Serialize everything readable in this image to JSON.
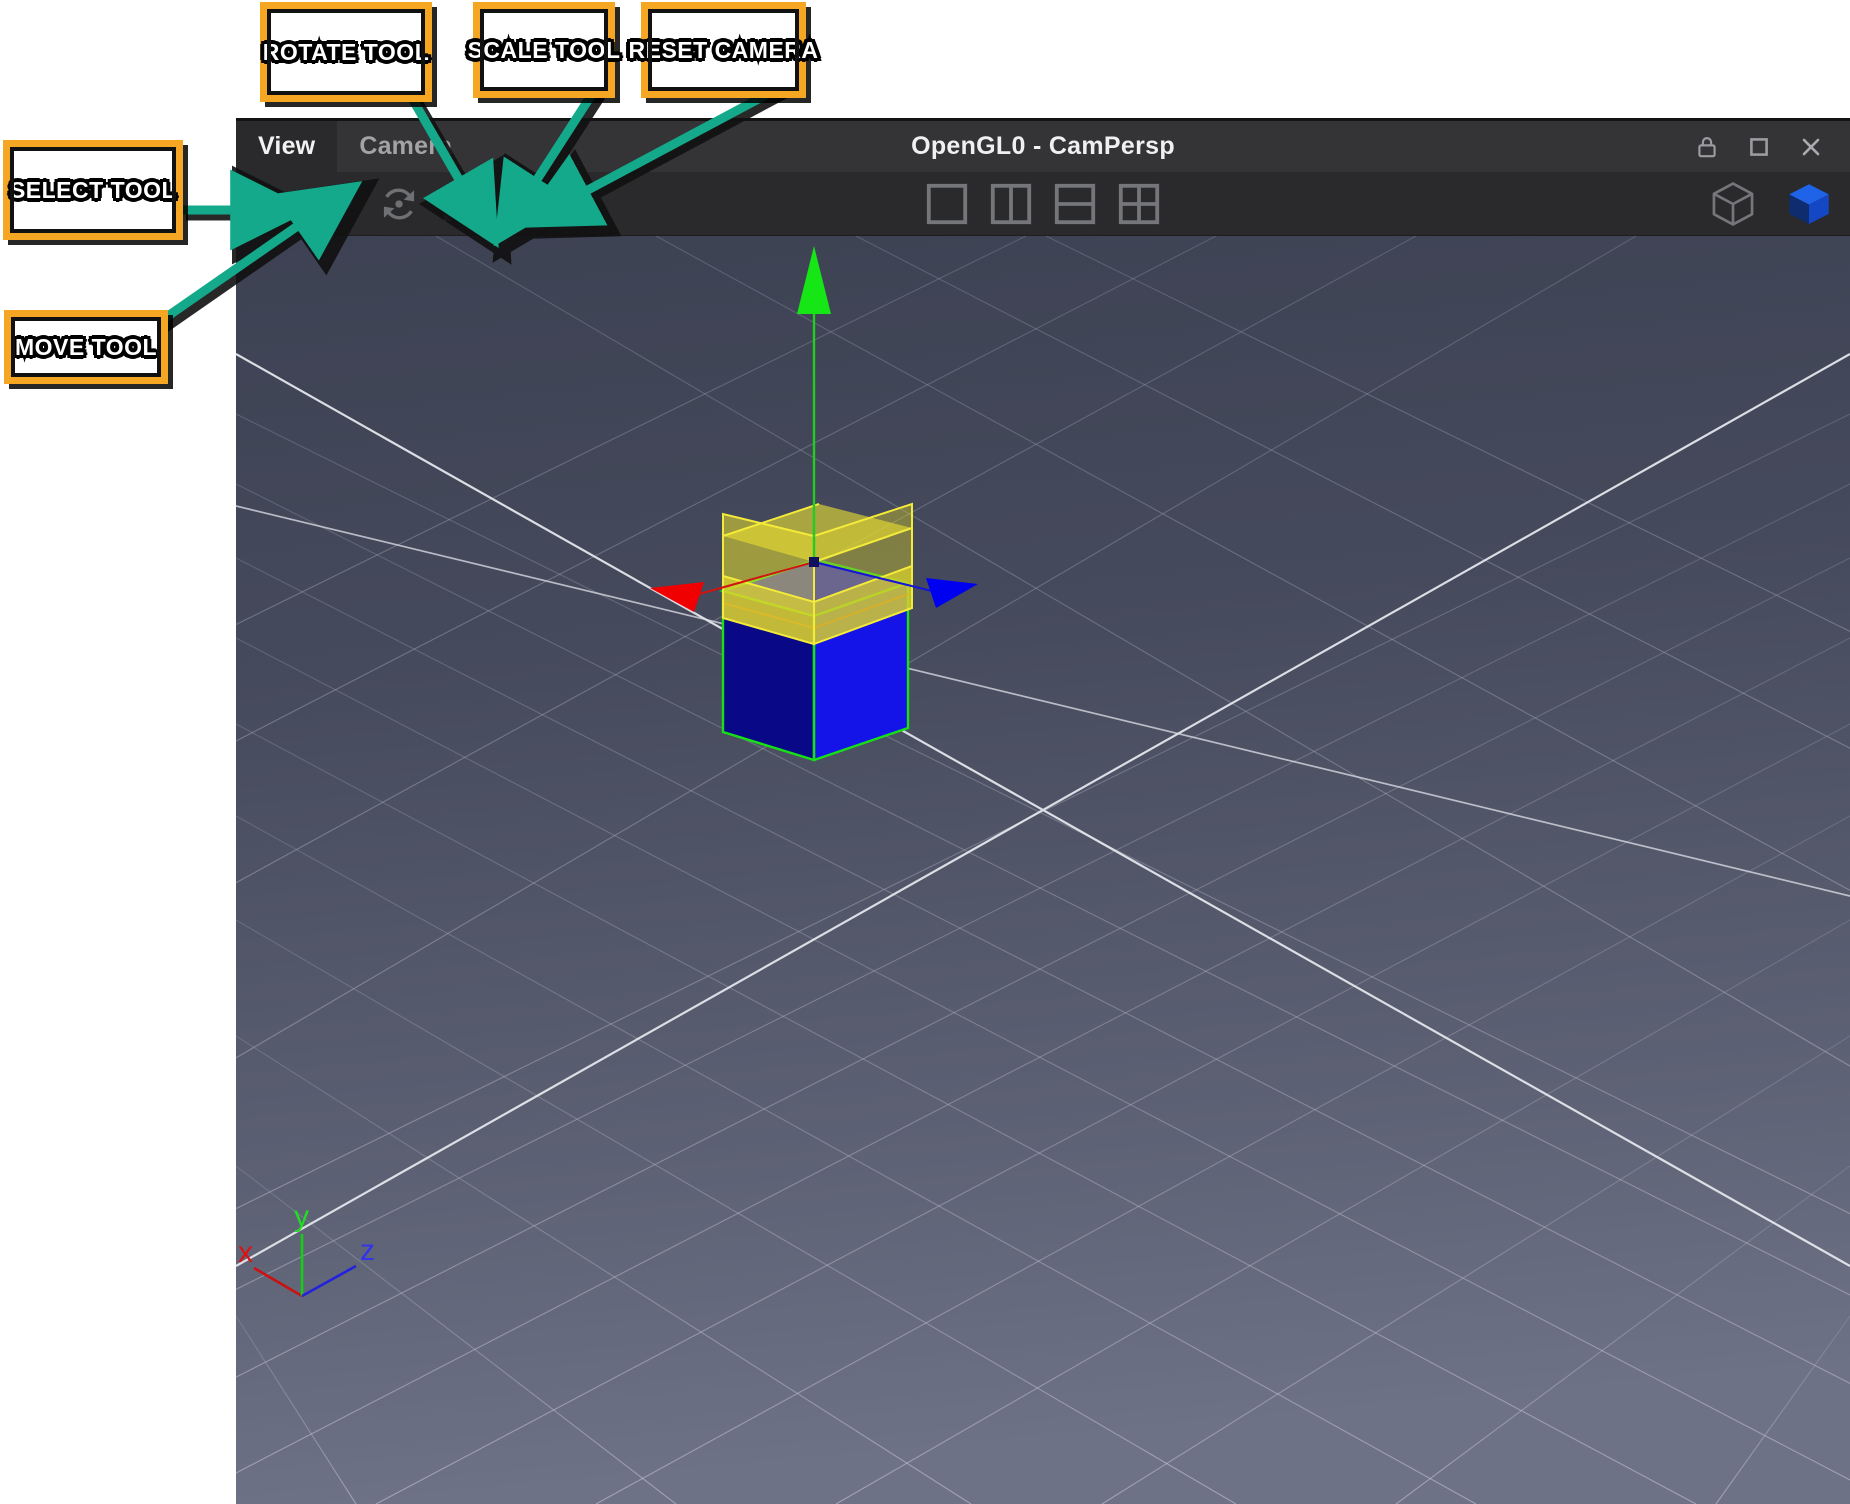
{
  "window": {
    "title": "OpenGL0 - CamPersp",
    "menu_tabs": [
      {
        "label": "View",
        "active": true
      },
      {
        "label": "Camera",
        "active": false
      }
    ],
    "controls": [
      {
        "name": "lock-icon",
        "label": "Lock"
      },
      {
        "name": "maximize-icon",
        "label": "Maximize"
      },
      {
        "name": "close-icon",
        "label": "Close"
      }
    ]
  },
  "toolbar": {
    "tools": [
      {
        "name": "select-tool",
        "label": "Select Tool",
        "icon": "cursor-arrow-icon",
        "active": false
      },
      {
        "name": "move-tool",
        "label": "Move Tool",
        "icon": "move-arrows-icon",
        "active": true
      },
      {
        "name": "rotate-tool",
        "label": "Rotate Tool",
        "icon": "rotate-circular-arrows-icon",
        "active": false
      },
      {
        "name": "scale-tool",
        "label": "Scale Tool",
        "icon": "scale-square-icon",
        "active": false
      },
      {
        "name": "reset-camera",
        "label": "Reset Camera",
        "icon": "film-camera-icon",
        "active": false
      }
    ],
    "layouts": [
      {
        "name": "layout-single",
        "label": "Single viewport"
      },
      {
        "name": "layout-two-vertical",
        "label": "Two viewports vertical split"
      },
      {
        "name": "layout-two-horizontal",
        "label": "Two viewports horizontal split"
      },
      {
        "name": "layout-quad",
        "label": "Four viewports"
      }
    ],
    "shading": [
      {
        "name": "wireframe-cube-icon",
        "label": "Wireframe shading",
        "active": false
      },
      {
        "name": "solid-cube-icon",
        "label": "Solid shading",
        "active": true
      }
    ]
  },
  "viewport": {
    "axis_gizmo": {
      "x_label": "x",
      "y_label": "y",
      "z_label": "z",
      "x_color": "#d42020",
      "y_color": "#24d424",
      "z_color": "#2a2ae0"
    },
    "object": {
      "name": "cube",
      "face_color": "#1a1aee",
      "face_color_dark": "#0a0a8c",
      "selection_edge_color": "#00e000",
      "gizmo_plane_color": "#e8e033",
      "axis_arrow_colors": {
        "x": "#ee0000",
        "y": "#22dd22",
        "z": "#2222ee"
      }
    },
    "grid": {
      "minor_color": "#8d93a6",
      "major_color": "#e9eaee",
      "background_top": "#3f4455",
      "background_bottom": "#6a6e82"
    }
  },
  "annotations": [
    {
      "name": "callout-select-tool",
      "label": "SELECT TOOL"
    },
    {
      "name": "callout-move-tool",
      "label": "MOVE TOOL"
    },
    {
      "name": "callout-rotate-tool",
      "label": "ROTATE TOOL"
    },
    {
      "name": "callout-scale-tool",
      "label": "SCALE TOOL"
    },
    {
      "name": "callout-reset-camera",
      "label": "RESET CAMERA"
    }
  ],
  "annotation_style": {
    "arrow_color": "#14a98a",
    "box_border_color": "#f5a623",
    "box_fill_color": "#ffffff"
  }
}
